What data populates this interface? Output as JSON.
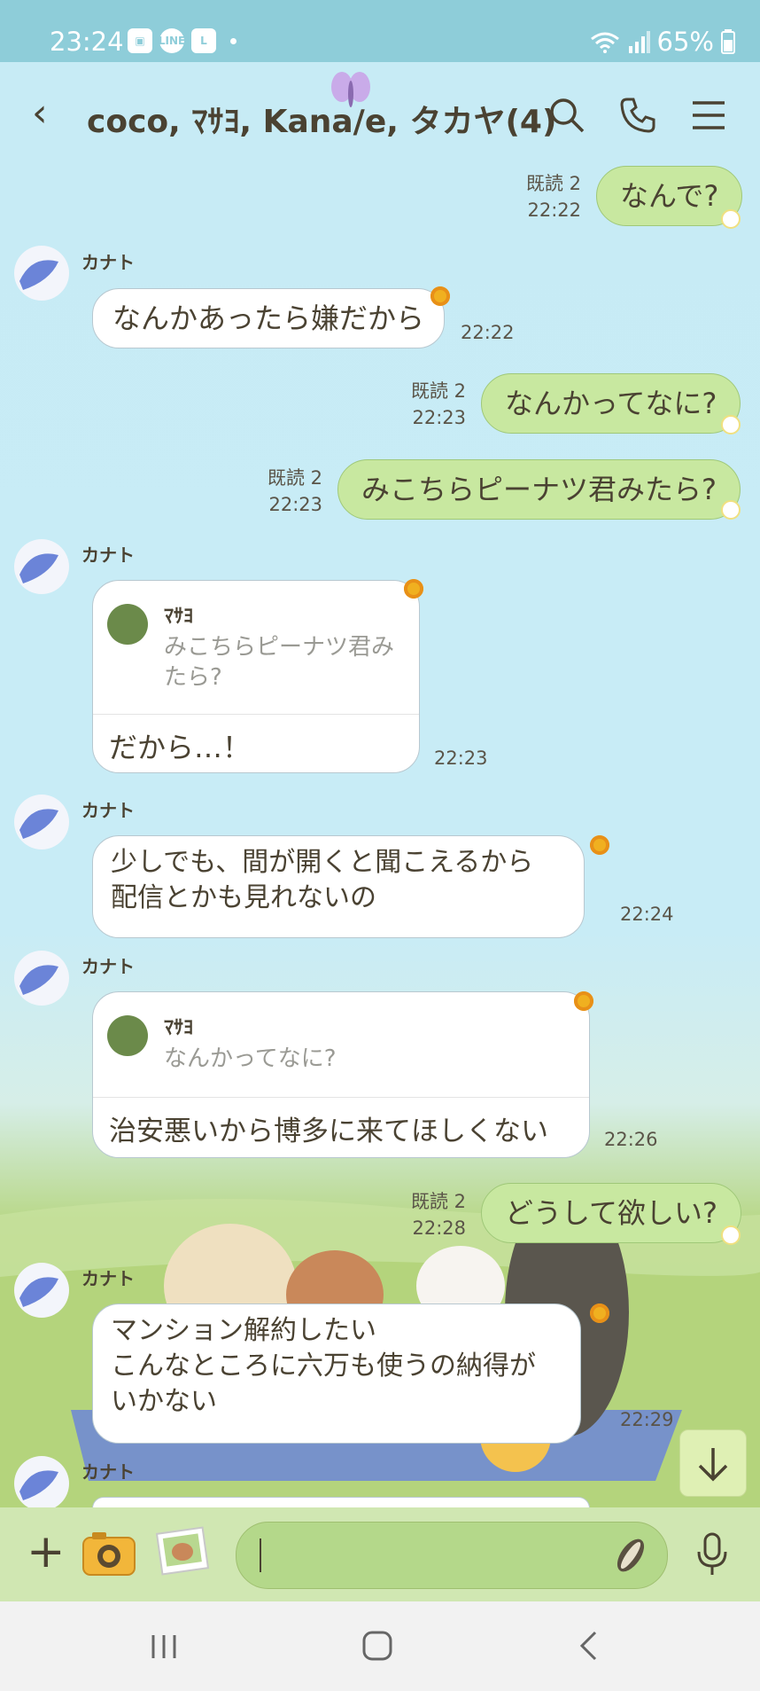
{
  "status_bar": {
    "time": "23:24",
    "battery": "65%",
    "notification_icons": [
      "gallery-icon",
      "line-icon",
      "l-app-icon"
    ]
  },
  "header": {
    "title": "coco, ﾏｻﾖ, Kana/e, タカヤ(4)"
  },
  "messages": [
    {
      "side": "me",
      "read": "既読 2",
      "time": "22:22",
      "text": "なんで?"
    },
    {
      "side": "them",
      "sender": "カナト",
      "time": "22:22",
      "text": "なんかあったら嫌だから"
    },
    {
      "side": "me",
      "read": "既読 2",
      "time": "22:23",
      "text": "なんかってなに?"
    },
    {
      "side": "me",
      "read": "既読 2",
      "time": "22:23",
      "text": "みこちらピーナツ君みたら?"
    },
    {
      "side": "them",
      "sender": "カナト",
      "time": "22:23",
      "quote_name": "ﾏｻﾖ",
      "quote_text": "みこちらピーナツ君み\nたら?",
      "text": "だから…！"
    },
    {
      "side": "them",
      "sender": "カナト",
      "time": "22:24",
      "text": "少しでも、間が開くと聞こえるから\n配信とかも見れないの"
    },
    {
      "side": "them",
      "sender": "カナト",
      "time": "22:26",
      "quote_name": "ﾏｻﾖ",
      "quote_text": "なんかってなに?",
      "text": "治安悪いから博多に来てほしくない"
    },
    {
      "side": "me",
      "read": "既読 2",
      "time": "22:28",
      "text": "どうして欲しい?"
    },
    {
      "side": "them",
      "sender": "カナト",
      "time": "22:29",
      "text": "マンション解約したい\nこんなところに六万も使うの納得が\nいかない"
    },
    {
      "side": "them",
      "sender": "カナト"
    }
  ],
  "colors": {
    "status_bar": "#8ecdd9",
    "my_bubble": "#c8e8a0",
    "their_bubble": "#ffffff",
    "text": "#4a4232",
    "input_bar": "#d0e7b2"
  }
}
